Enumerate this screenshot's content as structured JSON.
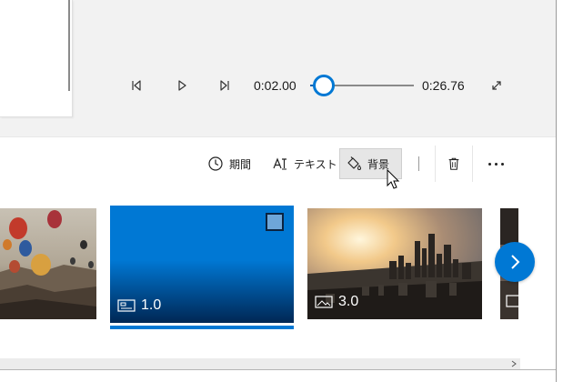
{
  "player": {
    "current_time": "0:02.00",
    "total_time": "0:26.76",
    "progress_fraction": 0.075,
    "icons": [
      "prev-frame-icon",
      "play-icon",
      "next-frame-icon",
      "fullscreen-icon"
    ]
  },
  "toolbar": {
    "duration_label": "期間",
    "text_label": "テキスト",
    "background_label": "背景",
    "icons": [
      "clock-icon",
      "text-icon",
      "paint-bucket-icon",
      "trash-icon",
      "more-icon"
    ]
  },
  "storyboard": {
    "clips": [
      {
        "kind": "image",
        "label": "",
        "scene": "hot-air-balloons"
      },
      {
        "kind": "title-card",
        "label": "1.0",
        "selected": true
      },
      {
        "kind": "image",
        "label": "3.0",
        "scene": "city-skyline-sunset"
      },
      {
        "kind": "image",
        "label": "",
        "scene": "partial"
      }
    ],
    "colors": {
      "accent": "#0078d4",
      "selection": "#0078d4"
    }
  }
}
